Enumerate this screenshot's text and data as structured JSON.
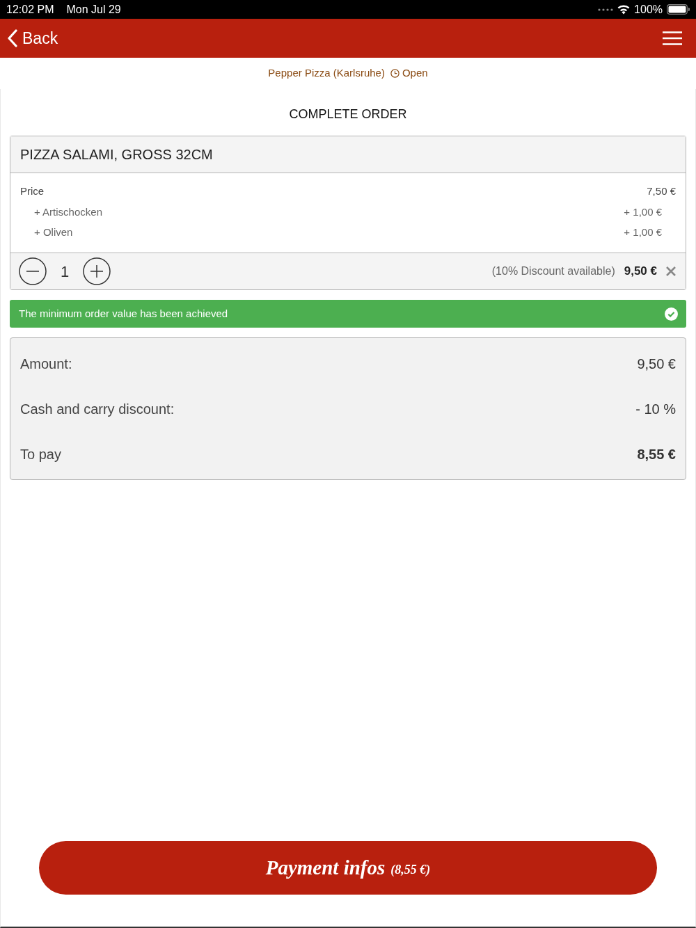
{
  "status_bar": {
    "time": "12:02 PM",
    "date": "Mon Jul 29",
    "battery": "100%"
  },
  "nav": {
    "back": "Back"
  },
  "store": {
    "name": "Pepper Pizza (Karlsruhe)",
    "status": "Open"
  },
  "title": "COMPLETE ORDER",
  "order_items": [
    {
      "name": "PIZZA SALAMI, GROSS 32CM",
      "price_label": "Price",
      "price": "7,50 €",
      "extras": [
        {
          "name": "+ Artischocken",
          "price": "+ 1,00 €"
        },
        {
          "name": "+ Oliven",
          "price": "+ 1,00 €"
        }
      ],
      "quantity": "1",
      "discount_note": "(10% Discount available)",
      "total": "9,50 €"
    }
  ],
  "notice": {
    "text": "The minimum order value has been achieved"
  },
  "summary": [
    {
      "kind": "plain",
      "label": "Amount:",
      "value": "9,50 €"
    },
    {
      "kind": "plain",
      "label": "Cash and carry discount:",
      "value": "- 10 %"
    },
    {
      "kind": "total",
      "label": "To pay",
      "value": "8,55 €"
    }
  ],
  "pay_button": {
    "label": "Payment infos",
    "amount": "(8,55 €)"
  }
}
